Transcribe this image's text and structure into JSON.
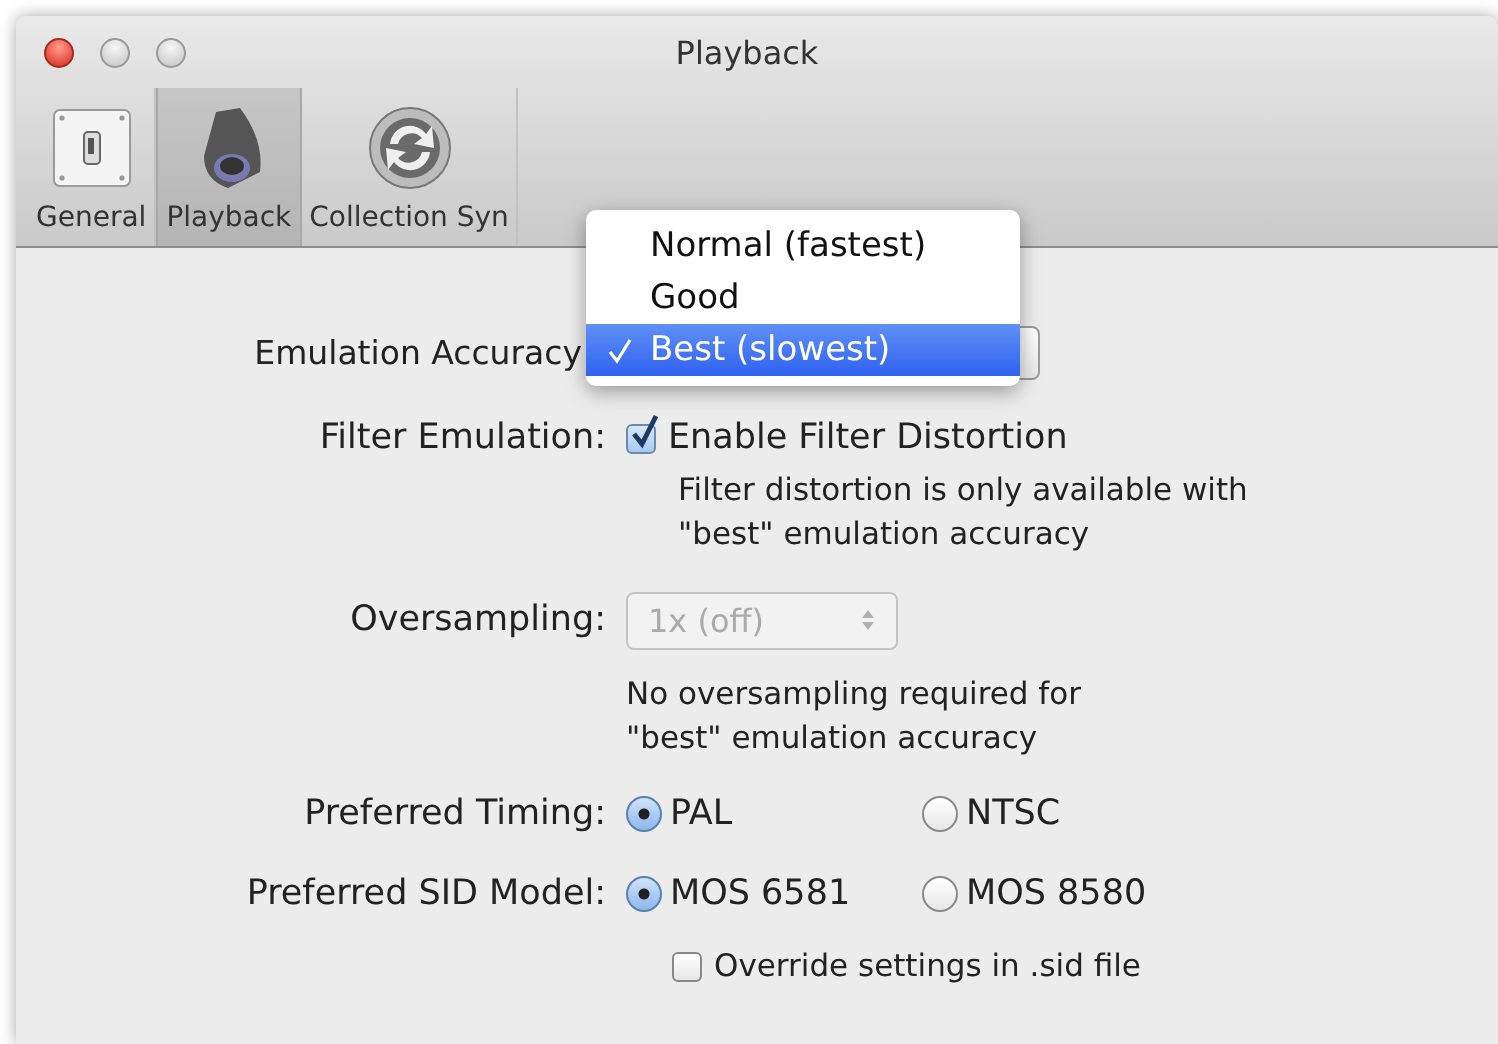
{
  "window": {
    "title": "Playback"
  },
  "toolbar": [
    {
      "label": "General",
      "selected": false,
      "kind": "switch"
    },
    {
      "label": "Playback",
      "selected": true,
      "kind": "speaker"
    },
    {
      "label": "Collection Syn",
      "selected": false,
      "kind": "sync"
    }
  ],
  "settings": [
    {
      "kind": "popup",
      "label": "Emulation Accuracy"
    },
    {
      "kind": "checkbox",
      "label": "Filter Emulation:",
      "option": "Enable Filter Distortion",
      "checked": true,
      "note": [
        "Filter distortion is only available with",
        "\"best\" emulation accuracy"
      ]
    },
    {
      "kind": "select",
      "label": "Oversampling:",
      "value": "1x (off)",
      "disabled": true,
      "note": [
        "No oversampling required for",
        "\"best\" emulation accuracy"
      ]
    },
    {
      "kind": "radio",
      "label": "Preferred Timing:",
      "options": [
        {
          "label": "PAL",
          "selected": true
        },
        {
          "label": "NTSC",
          "selected": false
        }
      ]
    },
    {
      "kind": "radio",
      "label": "Preferred SID Model:",
      "options": [
        {
          "label": "MOS 6581",
          "selected": true
        },
        {
          "label": "MOS 8580",
          "selected": false
        }
      ]
    },
    {
      "kind": "checkbox",
      "option": "Override settings in .sid file",
      "checked": false
    }
  ],
  "accuracy_menu": {
    "items": [
      {
        "label": "Normal (fastest)",
        "selected": false
      },
      {
        "label": "Good",
        "selected": false
      },
      {
        "label": "Best (slowest)",
        "selected": true
      }
    ]
  }
}
